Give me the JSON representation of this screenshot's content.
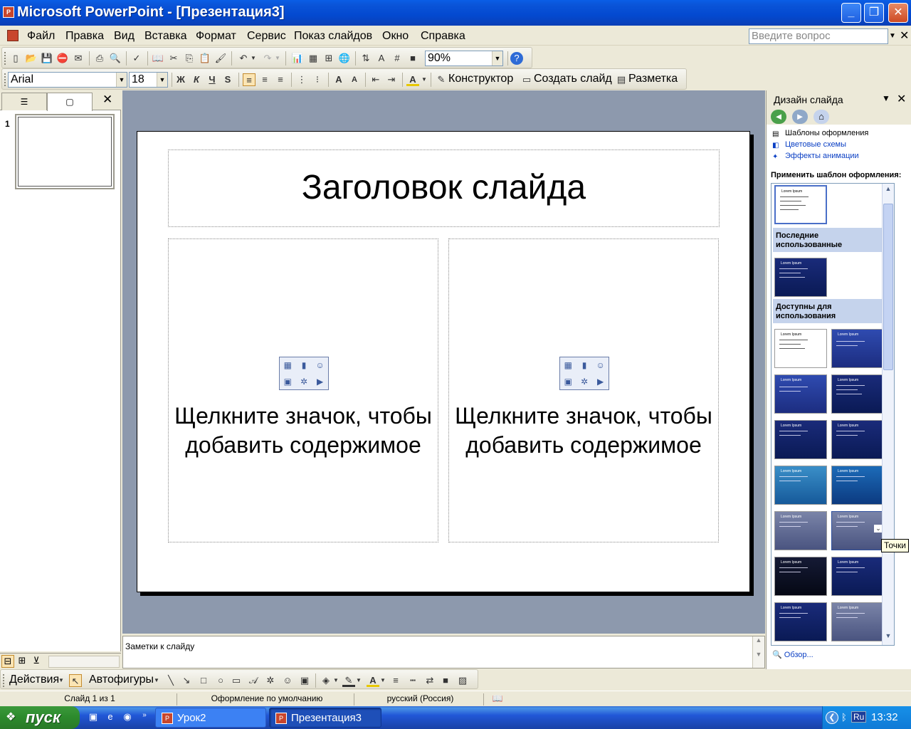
{
  "window": {
    "title": "Microsoft PowerPoint - [Презентация3]",
    "app_icon": "powerpoint-icon",
    "controls": {
      "minimize": "_",
      "restore": "❐",
      "close": "✕"
    }
  },
  "menubar": {
    "items": [
      "Файл",
      "Правка",
      "Вид",
      "Вставка",
      "Формат",
      "Сервис",
      "Показ слайдов",
      "Окно",
      "Справка"
    ],
    "ask_placeholder": "Введите вопрос"
  },
  "toolbar_standard": {
    "zoom": "90%"
  },
  "toolbar_format": {
    "font": "Arial",
    "size": "18",
    "bold": "Ж",
    "italic": "К",
    "underline": "Ч",
    "shadow": "S",
    "designer": "Конструктор",
    "new_slide": "Создать слайд",
    "layout": "Разметка"
  },
  "left_pane": {
    "slide_number": "1"
  },
  "slide": {
    "title": "Заголовок слайда",
    "placeholder_left": "Щелкните значок, чтобы добавить содержимое",
    "placeholder_right": "Щелкните значок, чтобы добавить содержимое"
  },
  "notes": {
    "label": "Заметки к слайду"
  },
  "task_pane": {
    "title": "Дизайн слайда",
    "links": [
      "Шаблоны оформления",
      "Цветовые схемы",
      "Эффекты анимации"
    ],
    "apply_label": "Применить шаблон оформления:",
    "section_recent": "Последние использованные",
    "section_available": "Доступны для использования",
    "browse": "Обзор...",
    "tooltip": "Точки"
  },
  "drawing_toolbar": {
    "actions": "Действия",
    "autoshapes": "Автофигуры"
  },
  "statusbar": {
    "slide": "Слайд 1 из 1",
    "design": "Оформление по умолчанию",
    "language": "русский (Россия)"
  },
  "taskbar": {
    "start": "пуск",
    "tasks": [
      "Урок2",
      "Презентация3"
    ],
    "tray_lang": "Ru",
    "clock": "13:32"
  }
}
